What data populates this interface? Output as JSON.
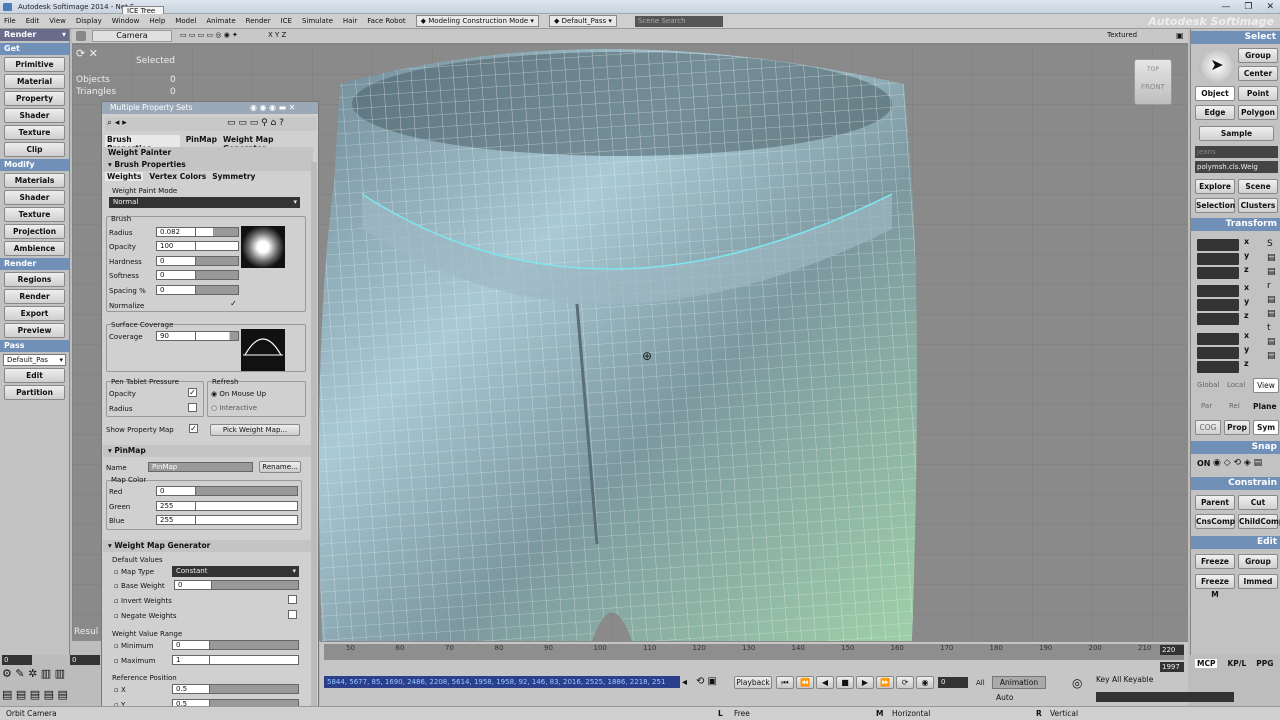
{
  "window": {
    "title": "Autodesk Softimage 2014 - Not F...",
    "ice_tab": "ICE Tree",
    "brand": "Autodesk Softimage",
    "controls": [
      "—",
      "❐",
      "✕"
    ]
  },
  "menu": {
    "items": [
      "File",
      "Edit",
      "View",
      "Display",
      "Window",
      "Help",
      "Model",
      "Animate",
      "Render",
      "ICE",
      "Simulate",
      "Hair",
      "Face Robot"
    ],
    "mode": "Modeling Construction Mode",
    "pass": "Default_Pass",
    "search_placeholder": "Scene Search"
  },
  "left_toolbar": {
    "mode": "Render",
    "get_header": "Get",
    "get_items": [
      "Primitive",
      "Material",
      "Property",
      "Shader",
      "Texture",
      "Clip"
    ],
    "modify_header": "Modify",
    "modify_items": [
      "Materials",
      "Shader",
      "Texture",
      "Projection",
      "Ambience"
    ],
    "render_header": "Render",
    "render_items": [
      "Regions",
      "Render",
      "Export",
      "Preview"
    ],
    "pass_header": "Pass",
    "pass_value": "Default_Pas",
    "pass_items": [
      "Edit",
      "Partition"
    ]
  },
  "viewport": {
    "camera": "Camera",
    "axes": "X Y Z",
    "shading": "Textured",
    "selected_label": "Selected",
    "stats": [
      {
        "label": "Objects",
        "value": "0"
      },
      {
        "label": "Triangles",
        "value": "0"
      }
    ],
    "cube_top": "TOP",
    "cube_front": "FRONT",
    "result_label": "Resul"
  },
  "property_panel": {
    "title": "Multiple Property Sets",
    "tabs": [
      "Brush Properties",
      "PinMap",
      "Weight Map Generator"
    ],
    "weight_painter": "Weight Painter",
    "brush_properties": "Brush Properties",
    "subtabs": [
      "Weights",
      "Vertex Colors",
      "Symmetry"
    ],
    "weight_paint_mode_label": "Weight Paint Mode",
    "weight_paint_mode": "Normal",
    "brush_group": "Brush",
    "brush_fields": [
      {
        "label": "Radius",
        "value": "0.082"
      },
      {
        "label": "Opacity",
        "value": "100"
      },
      {
        "label": "Hardness",
        "value": "0"
      },
      {
        "label": "Softness",
        "value": "0"
      },
      {
        "label": "Spacing %",
        "value": "0"
      }
    ],
    "normalize_label": "Normalize",
    "surface_coverage_group": "Surface Coverage",
    "coverage_label": "Coverage",
    "coverage_value": "90",
    "pen_tablet_group": "Pen Tablet Pressure",
    "pen_opacity": "Opacity",
    "pen_radius": "Radius",
    "refresh_group": "Refresh",
    "refresh_on_mouse_up": "On Mouse Up",
    "refresh_interactive": "Interactive",
    "show_property_map": "Show Property Map",
    "pick_weight_map": "Pick Weight Map...",
    "pinmap_header": "PinMap",
    "name_label": "Name",
    "name_value": "PinMap",
    "rename_button": "Rename...",
    "map_color_group": "Map Color",
    "colors": [
      {
        "label": "Red",
        "value": "0"
      },
      {
        "label": "Green",
        "value": "255"
      },
      {
        "label": "Blue",
        "value": "255"
      }
    ],
    "wmg_header": "Weight Map Generator",
    "default_values_group": "Default Values",
    "map_type_label": "Map Type",
    "map_type_value": "Constant",
    "base_weight_label": "Base Weight",
    "base_weight_value": "0",
    "invert_weights": "Invert Weights",
    "negate_weights": "Negate Weights",
    "weight_value_range_group": "Weight Value Range",
    "minimum_label": "Minimum",
    "minimum_value": "0",
    "maximum_label": "Maximum",
    "maximum_value": "1",
    "reference_position_group": "Reference Position",
    "ref_x_label": "X",
    "ref_x_value": "0.5",
    "ref_y_label": "Y",
    "ref_y_value": "0.5"
  },
  "right_panel": {
    "select_header": "Select",
    "group": "Group",
    "center": "Center",
    "object": "Object",
    "point": "Point",
    "edge": "Edge",
    "polygon": "Polygon",
    "sample": "Sample",
    "filter_value": "jeans",
    "selection_value": "polymsh.cls.Weig",
    "explore": "Explore",
    "scene": "Scene",
    "selection": "Selection",
    "clusters": "Clusters",
    "transform_header": "Transform",
    "axis_labels": [
      "x",
      "y",
      "z",
      "x",
      "y",
      "z",
      "x",
      "y",
      "z"
    ],
    "ref_modes": [
      "Global",
      "Local",
      "View",
      "Par",
      "Rel",
      "Plane"
    ],
    "cog": "COG",
    "prop": "Prop",
    "sym": "Sym",
    "snap_header": "Snap",
    "snap_on": "ON",
    "constrain_header": "Constrain",
    "parent": "Parent",
    "cut": "Cut",
    "cnscomp": "CnsComp",
    "childcomp": "ChildComp",
    "edit_header": "Edit",
    "freeze": "Freeze",
    "edit_group": "Group",
    "freeze_m": "Freeze M",
    "immed": "Immed"
  },
  "timeline": {
    "ticks": [
      "50",
      "60",
      "70",
      "80",
      "90",
      "100",
      "110",
      "120",
      "130",
      "140",
      "150",
      "160",
      "170",
      "180",
      "190",
      "200",
      "210"
    ],
    "frame_list": "5844, 5677, 85, 1690, 2486, 2208, 5614, 1958, 1958, 92, 146, 83, 2016, 2525, 1886, 2218, 251",
    "end_frame": "220",
    "total_frames": "1997",
    "playback": "Playback",
    "current_frame": "0",
    "all": "All",
    "animation": "Animation",
    "auto": "Auto",
    "key_all_keyable": "Key All Keyable",
    "tabs": [
      "MCP",
      "KP/L",
      "PPG"
    ]
  },
  "status": {
    "left": "Orbit Camera",
    "l_label": "L",
    "l_text": "Free",
    "m_label": "M",
    "m_text": "Horizontal",
    "r_label": "R",
    "r_text": "Vertical"
  },
  "left_bottom": {
    "values": [
      "0",
      "0"
    ]
  }
}
